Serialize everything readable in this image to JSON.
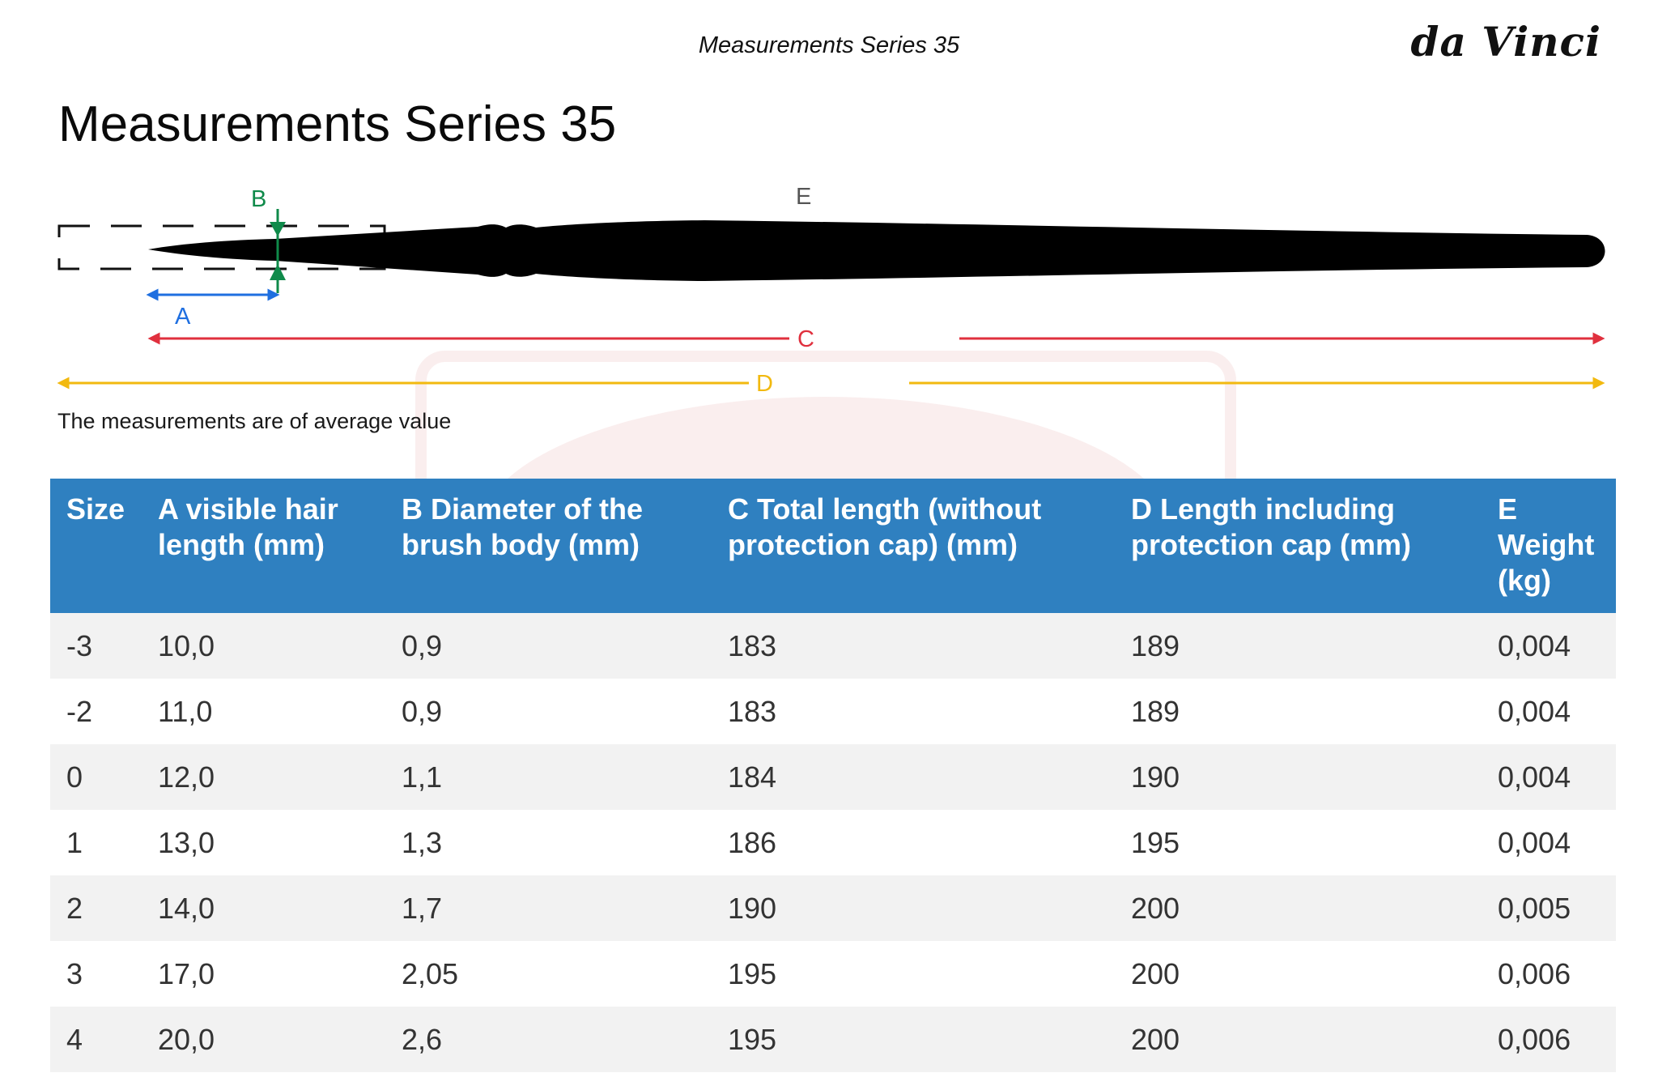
{
  "header": {
    "title": "Measurements Series 35",
    "brand": "da Vinci"
  },
  "page_title": "Measurements Series 35",
  "diagram": {
    "label_a": "A",
    "label_b": "B",
    "label_c": "C",
    "label_d": "D",
    "label_e": "E",
    "colors": {
      "a": "#1f6fe0",
      "b": "#0f8a4a",
      "c": "#e0303e",
      "d": "#f2b90f",
      "brush": "#000000"
    }
  },
  "note": "The measurements are of average value",
  "table": {
    "headers": [
      "Size",
      "A visible hair length (mm)",
      "B Diameter of the brush body (mm)",
      "C Total length (without protection cap) (mm)",
      "D Length including protection cap (mm)",
      "E Weight (kg)"
    ],
    "rows": [
      [
        "-3",
        "10,0",
        "0,9",
        "183",
        "189",
        "0,004"
      ],
      [
        "-2",
        "11,0",
        "0,9",
        "183",
        "189",
        "0,004"
      ],
      [
        "0",
        "12,0",
        "1,1",
        "184",
        "190",
        "0,004"
      ],
      [
        "1",
        "13,0",
        "1,3",
        "186",
        "195",
        "0,004"
      ],
      [
        "2",
        "14,0",
        "1,7",
        "190",
        "200",
        "0,005"
      ],
      [
        "3",
        "17,0",
        "2,05",
        "195",
        "200",
        "0,006"
      ],
      [
        "4",
        "20,0",
        "2,6",
        "195",
        "200",
        "0,006"
      ]
    ],
    "header_color": "#2f80c0"
  }
}
